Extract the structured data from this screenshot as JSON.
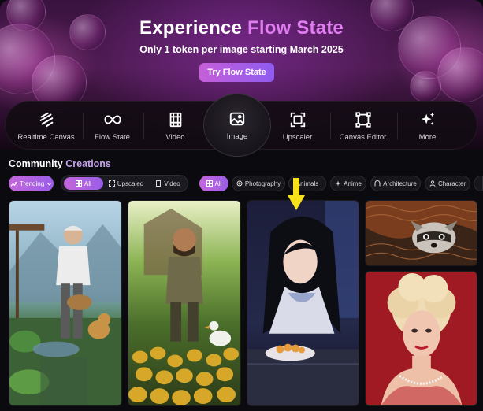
{
  "hero": {
    "title_main": "Experience",
    "title_accent": "Flow State",
    "subtitle": "Only 1 token per image starting March 2025",
    "cta_label": "Try Flow State"
  },
  "tools": [
    {
      "label": "Realtime Canvas",
      "icon": "scribble-icon"
    },
    {
      "label": "Flow State",
      "icon": "infinity-icon"
    },
    {
      "label": "Video",
      "icon": "film-icon"
    },
    {
      "label": "Image",
      "icon": "image-icon",
      "active": true
    },
    {
      "label": "Upscaler",
      "icon": "upscale-icon"
    },
    {
      "label": "Canvas Editor",
      "icon": "crop-frame-icon"
    },
    {
      "label": "More",
      "icon": "sparkles-icon"
    }
  ],
  "community": {
    "title_plain": "Community",
    "title_rest": "Creations",
    "sort_label": "Trending",
    "type_filters": [
      "All",
      "Upscaled",
      "Video"
    ],
    "category_filters": [
      "All",
      "Photography",
      "Animals",
      "Anime",
      "Architecture",
      "Character"
    ]
  },
  "gallery": [
    {
      "subject": "elderly man with basket and dog in garden"
    },
    {
      "subject": "bearded man with golden eggs and duck"
    },
    {
      "subject": "anime girl eating at table"
    },
    {
      "subject": "raccoon under knitted blanket"
    },
    {
      "subject": "vintage woman portrait on red background"
    }
  ],
  "colors": {
    "accent": "#e07df0",
    "cta_gradient_start": "#c65fd9",
    "cta_gradient_end": "#8f5bf0",
    "background": "#0b0b0f"
  }
}
